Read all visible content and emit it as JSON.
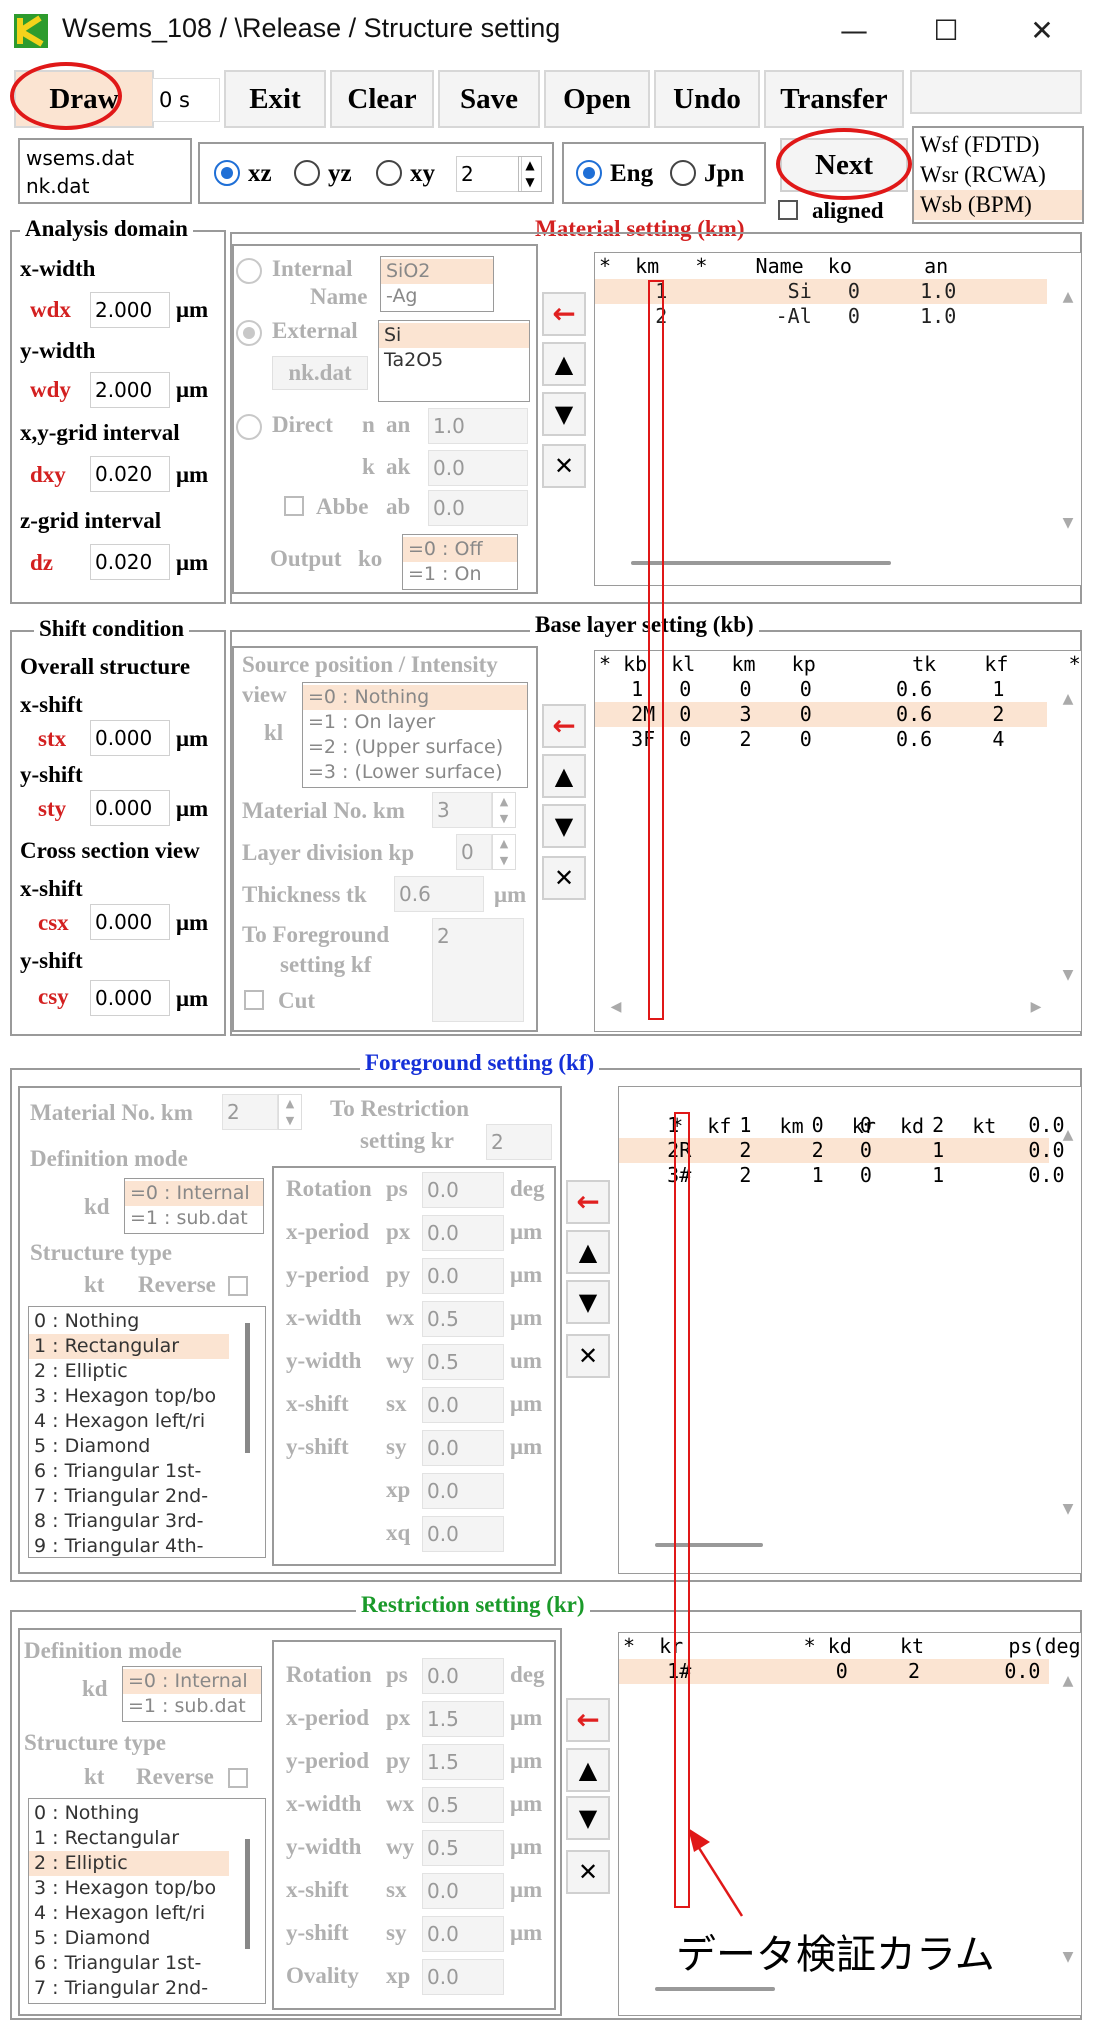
{
  "window": {
    "title": "Wsems_108 / \\Release / Structure setting",
    "min_icon": "minimize-icon",
    "max_icon": "maximize-icon",
    "close_icon": "close-icon"
  },
  "toolbar": {
    "draw": "Draw",
    "time": "0 s",
    "exit": "Exit",
    "clear": "Clear",
    "save": "Save",
    "open": "Open",
    "undo": "Undo",
    "transfer": "Transfer"
  },
  "files": {
    "dat1": "wsems.dat",
    "dat2": "nk.dat"
  },
  "view_plane": {
    "xz": "xz",
    "yz": "yz",
    "xy": "xy",
    "xy_value": "2"
  },
  "language": {
    "eng": "Eng",
    "jpn": "Jpn"
  },
  "next": "Next",
  "aligned": "aligned",
  "solvers": [
    "Wsf (FDTD)",
    "Wsr (RCWA)",
    "Wsb (BPM)"
  ],
  "analysis": {
    "title": "Analysis domain",
    "xwidth": "x-width",
    "wdx": "wdx",
    "wdx_val": "2.000",
    "ywidth": "y-width",
    "wdy": "wdy",
    "wdy_val": "2.000",
    "xygrid": "x,y-grid interval",
    "dxy": "dxy",
    "dxy_val": "0.020",
    "zgrid": "z-grid interval",
    "dz": "dz",
    "dz_val": "0.020",
    "unit": "μm"
  },
  "material_settings": {
    "title": "Material setting (km)",
    "internal": "Internal",
    "name": "Name",
    "internal_list": [
      "SiO2",
      "-Ag"
    ],
    "external": "External",
    "nkdat": "nk.dat",
    "external_list": [
      "Si",
      "Ta2O5"
    ],
    "direct": "Direct",
    "n": "n",
    "an": "an",
    "an_val": "1.0",
    "k": "k",
    "ak": "ak",
    "ak_val": "0.0",
    "abbe": "Abbe",
    "ab": "ab",
    "ab_val": "0.0",
    "output": "Output",
    "ko": "ko",
    "ko_list": [
      "=0 : Off",
      "=1 : On"
    ]
  },
  "material_grid": {
    "header": "*  km   *    Name  ko      an",
    "rows": [
      "     1          Si   0     1.0",
      "     2         -Al   0     1.0"
    ]
  },
  "shift": {
    "title": "Shift condition",
    "overall": "Overall structure",
    "xshift": "x-shift",
    "stx": "stx",
    "stx_val": "0.000",
    "yshift": "y-shift",
    "sty": "sty",
    "sty_val": "0.000",
    "cross": "Cross section view",
    "csx": "csx",
    "csx_val": "0.000",
    "csy": "csy",
    "csy_val": "0.000",
    "unit": "μm"
  },
  "base_layer": {
    "title": "Base layer setting (kb)",
    "source": "Source position / Intensity",
    "view": "view",
    "kl": "kl",
    "kl_list": [
      "=0 : Nothing",
      "=1 : On layer",
      "=2 : (Upper surface)",
      "=3 : (Lower surface)"
    ],
    "material_no": "Material No.  km",
    "km_val": "3",
    "layer_div": "Layer division   kp",
    "kp_val": "0",
    "thickness": "Thickness  tk",
    "tk_val": "0.6",
    "tk_unit": "μm",
    "to_fg": "To Foreground",
    "setting_kf": "setting   kf",
    "kf_val": "2",
    "cut": "Cut"
  },
  "base_grid": {
    "header": "* kb  kl   km   kp        tk    kf     *",
    "rows": [
      "   1   0    0    0       0.6     1",
      "   2M  0    3    0       0.6     2",
      "   3F  0    2    0       0.6     4"
    ]
  },
  "foreground": {
    "title": "Foreground setting (kf)",
    "material_no": "Material No.  km",
    "km_val": "2",
    "to_restr": "To Restriction",
    "setting_kr": "setting  kr",
    "kr_val": "2",
    "def_mode": "Definition mode",
    "kd": "kd",
    "kd_list": [
      "=0 : Internal",
      "=1 : sub.dat"
    ],
    "struct_type": "Structure type",
    "kt": "kt",
    "reverse": "Reverse",
    "kt_list": [
      "0 : Nothing",
      "1 : Rectangular",
      "2 : Elliptic",
      "3 : Hexagon top/bo",
      "4 : Hexagon left/ri",
      "5 : Diamond",
      "6 : Triangular 1st-",
      "7 : Triangular 2nd-",
      "8 : Triangular 3rd-",
      "9 : Triangular 4th-"
    ],
    "params": [
      [
        "Rotation",
        "ps",
        "0.0",
        "deg"
      ],
      [
        "x-period",
        "px",
        "0.0",
        "μm"
      ],
      [
        "y-period",
        "py",
        "0.0",
        "μm"
      ],
      [
        "x-width",
        "wx",
        "0.5",
        "μm"
      ],
      [
        "y-width",
        "wy",
        "0.5",
        "um"
      ],
      [
        "x-shift",
        "sx",
        "0.0",
        "μm"
      ],
      [
        "y-shift",
        "sy",
        "0.0",
        "μm"
      ],
      [
        "",
        "xp",
        "0.0",
        ""
      ],
      [
        "",
        "xq",
        "0.0",
        ""
      ]
    ]
  },
  "fg_grid": {
    "header": "*  kf    km    kr  kd    kt       ps(deg)",
    "rows": [
      "    1     1     0   0     2       0.0",
      "    2R    2     2   0     1       0.0",
      "    3#    2     1   0     1       0.0"
    ]
  },
  "restriction": {
    "title": "Restriction setting (kr)",
    "def_mode": "Definition mode",
    "kd": "kd",
    "kd_list": [
      "=0 : Internal",
      "=1 : sub.dat"
    ],
    "struct_type": "Structure type",
    "kt": "kt",
    "reverse": "Reverse",
    "kt_list": [
      "0 : Nothing",
      "1 : Rectangular",
      "2 : Elliptic",
      "3 : Hexagon top/bo",
      "4 : Hexagon left/ri",
      "5 : Diamond",
      "6 : Triangular 1st-",
      "7 : Triangular 2nd-"
    ],
    "params": [
      [
        "Rotation",
        "ps",
        "0.0",
        "deg"
      ],
      [
        "x-period",
        "px",
        "1.5",
        "μm"
      ],
      [
        "y-period",
        "py",
        "1.5",
        "μm"
      ],
      [
        "x-width",
        "wx",
        "0.5",
        "μm"
      ],
      [
        "y-width",
        "wy",
        "0.5",
        "μm"
      ],
      [
        "x-shift",
        "sx",
        "0.0",
        "μm"
      ],
      [
        "y-shift",
        "sy",
        "0.0",
        "μm"
      ],
      [
        "Ovality",
        "xp",
        "0.0",
        ""
      ]
    ]
  },
  "kr_grid": {
    "header": "*  kr          * kd    kt       ps(deg)",
    "rows": [
      "    1#            0     2       0.0"
    ]
  },
  "annotation": "データ検証カラム"
}
